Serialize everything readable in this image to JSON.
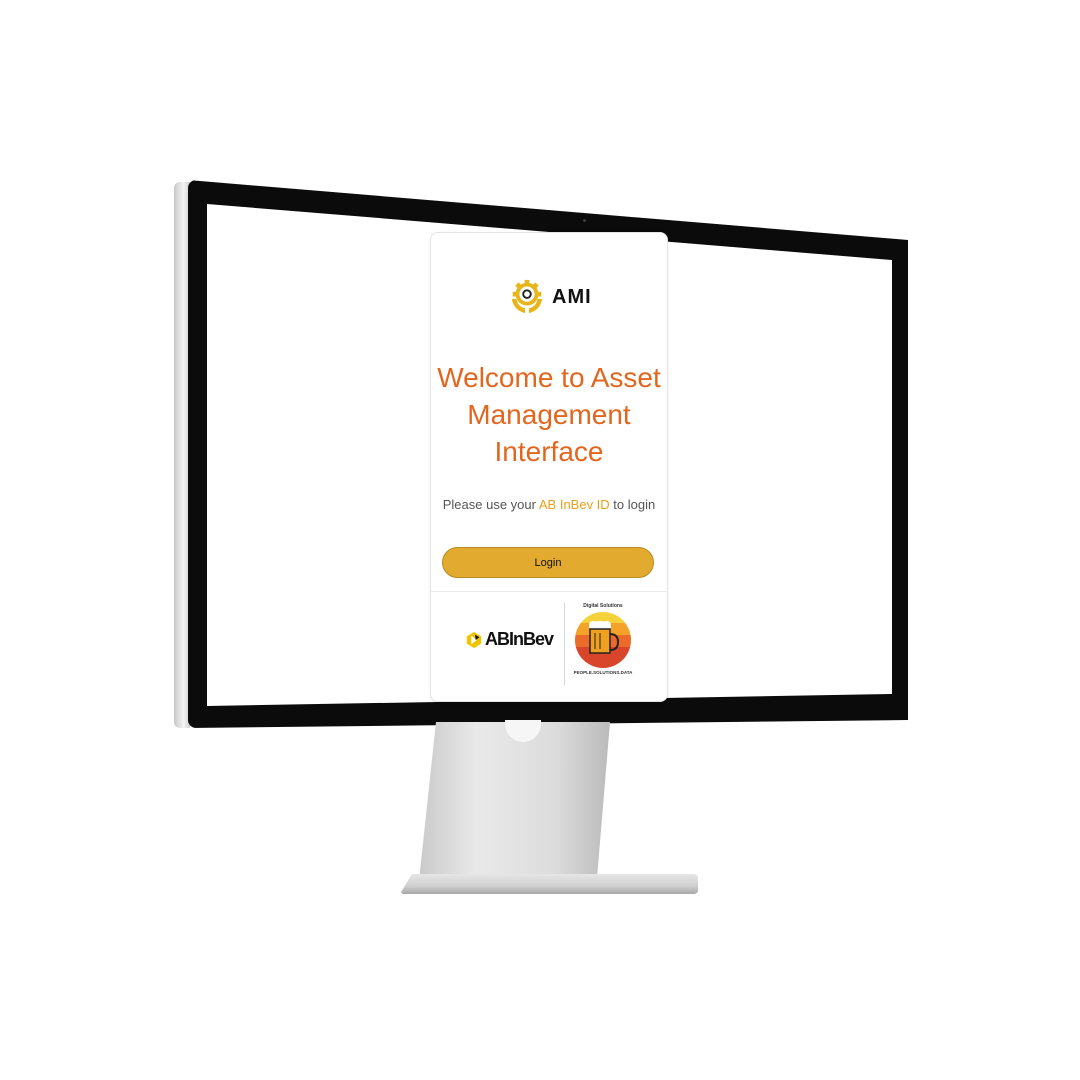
{
  "app": {
    "brand_name": "AMI",
    "brand_icon": "gear-hands-icon"
  },
  "login": {
    "title": "Welcome to Asset Management Interface",
    "instruction_prefix": "Please use your ",
    "instruction_highlight": "AB InBev ID",
    "instruction_suffix": " to login",
    "button_label": "Login"
  },
  "footer": {
    "partner_logo_text": "ABInBev",
    "partner_logo_icon": "abinbev-mark-icon",
    "ds_logo_top": "Digital Solutions",
    "ds_logo_bottom": "PEOPLE.SOLUTIONS.DATA",
    "ds_logo_icon": "beer-mug-icon"
  },
  "colors": {
    "title": "#e3661f",
    "accent": "#e7a21c",
    "button": "#e2aa2e",
    "text": "#555555"
  }
}
